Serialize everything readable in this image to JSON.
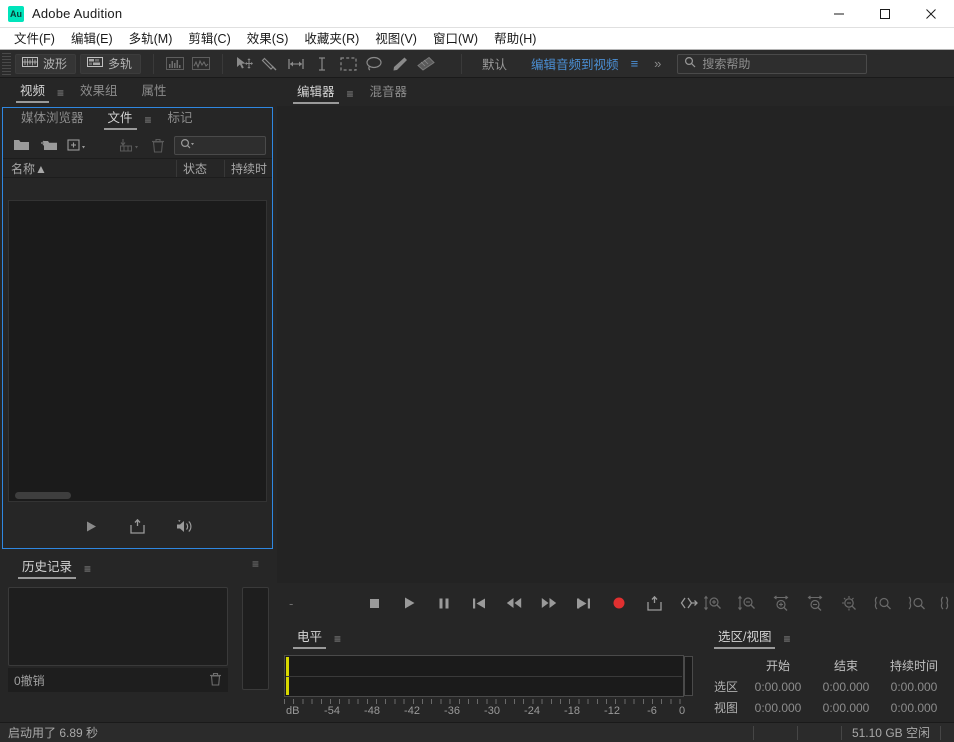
{
  "window": {
    "title": "Adobe Audition",
    "logo_text": "Au",
    "minimize": "minimize-icon",
    "maximize": "maximize-icon",
    "close": "close-icon"
  },
  "menubar": {
    "items": [
      {
        "label": "文件(F)"
      },
      {
        "label": "编辑(E)"
      },
      {
        "label": "多轨(M)"
      },
      {
        "label": "剪辑(C)"
      },
      {
        "label": "效果(S)"
      },
      {
        "label": "收藏夹(R)"
      },
      {
        "label": "视图(V)"
      },
      {
        "label": "窗口(W)"
      },
      {
        "label": "帮助(H)"
      }
    ]
  },
  "toolbar": {
    "waveform_label": "波形",
    "multitrack_label": "多轨",
    "workspace_default": "默认",
    "workspace_active": "编辑音频到视频",
    "workspace_menu_icon": "hamburger-icon",
    "more_icon": "chevron-double-right-icon",
    "search_placeholder": "搜索帮助",
    "accent_color": "#4b8fd4",
    "tools": [
      {
        "name": "spectral-frequency-icon"
      },
      {
        "name": "spectral-pitch-icon"
      },
      {
        "name": "move-tool-icon"
      },
      {
        "name": "slip-tool-icon"
      },
      {
        "name": "razor-tool-icon"
      },
      {
        "name": "time-selection-tool-icon"
      },
      {
        "name": "marquee-selection-tool-icon"
      },
      {
        "name": "lasso-selection-tool-icon"
      },
      {
        "name": "paintbrush-selection-tool-icon"
      },
      {
        "name": "spot-healing-brush-icon"
      }
    ]
  },
  "left_panel": {
    "top_tabs": [
      {
        "label": "视频",
        "active": true,
        "menu": true
      },
      {
        "label": "效果组",
        "active": false
      },
      {
        "label": "属性",
        "active": false
      }
    ],
    "files": {
      "tabs": [
        {
          "label": "媒体浏览器",
          "active": false
        },
        {
          "label": "文件",
          "active": true,
          "menu": true
        },
        {
          "label": "标记",
          "active": false
        }
      ],
      "toolbar_icons": [
        {
          "name": "open-file-icon"
        },
        {
          "name": "import-folder-icon"
        },
        {
          "name": "new-file-icon"
        },
        {
          "name": "save-file-icon"
        },
        {
          "name": "delete-file-icon"
        }
      ],
      "search_icon": "search-icon",
      "columns": [
        {
          "label": "名称",
          "sort": "▲"
        },
        {
          "label": "状态"
        },
        {
          "label": "持续时"
        }
      ],
      "rows": [],
      "transport_icons": [
        {
          "name": "play-icon"
        },
        {
          "name": "insert-into-multitrack-icon"
        },
        {
          "name": "auto-play-icon"
        }
      ]
    },
    "history": {
      "tab_label": "历史记录",
      "menu_icon": "hamburger-icon",
      "undo_count_label": "0撤销",
      "trash_icon": "trash-icon"
    },
    "sidestrip": {
      "tab_label": "≡"
    }
  },
  "editor": {
    "tabs": [
      {
        "label": "编辑器",
        "active": true,
        "menu": true
      },
      {
        "label": "混音器",
        "active": false
      }
    ],
    "time_display": "-",
    "transport_icons": [
      {
        "name": "stop-icon"
      },
      {
        "name": "play-icon"
      },
      {
        "name": "pause-icon"
      },
      {
        "name": "skip-to-start-icon"
      },
      {
        "name": "rewind-icon"
      },
      {
        "name": "fast-forward-icon"
      },
      {
        "name": "skip-to-end-icon"
      },
      {
        "name": "record-icon"
      },
      {
        "name": "loop-playback-icon"
      },
      {
        "name": "skip-selection-icon"
      }
    ],
    "record_color": "#e03030",
    "zoom_icons": [
      {
        "name": "zoom-in-amplitude-icon"
      },
      {
        "name": "zoom-out-amplitude-icon"
      },
      {
        "name": "zoom-in-time-icon"
      },
      {
        "name": "zoom-out-time-icon"
      },
      {
        "name": "zoom-out-full-icon"
      },
      {
        "name": "zoom-to-selection-in-point-icon"
      },
      {
        "name": "zoom-to-selection-out-point-icon"
      },
      {
        "name": "zoom-to-selection-icon"
      }
    ]
  },
  "levels": {
    "tab_label": "电平",
    "menu_icon": "hamburger-icon",
    "db_label": "dB",
    "scale_labels": [
      "-54",
      "-48",
      "-42",
      "-36",
      "-30",
      "-24",
      "-18",
      "-12",
      "-6",
      "0"
    ],
    "scale_positions": [
      12,
      22,
      32,
      42,
      52,
      62,
      72,
      82,
      92,
      99.5
    ],
    "meter_color": "#d8d800"
  },
  "selection_view": {
    "tab_label": "选区/视图",
    "menu_icon": "hamburger-icon",
    "headers": [
      "开始",
      "结束",
      "持续时间"
    ],
    "rows": [
      {
        "label": "选区",
        "start": "0:00.000",
        "end": "0:00.000",
        "duration": "0:00.000"
      },
      {
        "label": "视图",
        "start": "0:00.000",
        "end": "0:00.000",
        "duration": "0:00.000"
      }
    ]
  },
  "statusbar": {
    "left_text": "启动用了 6.89 秒",
    "free_space": "51.10 GB 空闲"
  }
}
